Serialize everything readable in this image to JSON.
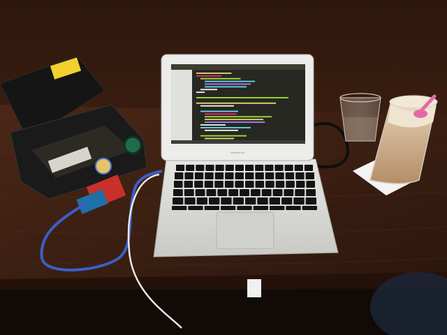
{
  "scene": {
    "laptop": {
      "brand_label": "MacBook Air",
      "editor_lines": [
        {
          "indent": 0,
          "len": 42,
          "color": "#e6db74"
        },
        {
          "indent": 0,
          "len": 30,
          "color": "#f92672"
        },
        {
          "indent": 1,
          "len": 48,
          "color": "#a6e22e"
        },
        {
          "indent": 2,
          "len": 60,
          "color": "#66d9ef"
        },
        {
          "indent": 2,
          "len": 55,
          "color": "#ae81ff"
        },
        {
          "indent": 2,
          "len": 50,
          "color": "#66d9ef"
        },
        {
          "indent": 1,
          "len": 20,
          "color": "#f8f8f2"
        },
        {
          "indent": 0,
          "len": 10,
          "color": "#f8f8f2"
        },
        {
          "indent": 0,
          "len": 0,
          "color": "#272822"
        },
        {
          "indent": 0,
          "len": 110,
          "color": "#a6e22e"
        },
        {
          "indent": 0,
          "len": 0,
          "color": "#272822"
        },
        {
          "indent": 0,
          "len": 95,
          "color": "#e6db74"
        },
        {
          "indent": 1,
          "len": 40,
          "color": "#f8f8f2"
        },
        {
          "indent": 0,
          "len": 0,
          "color": "#272822"
        },
        {
          "indent": 1,
          "len": 45,
          "color": "#66d9ef"
        },
        {
          "indent": 2,
          "len": 38,
          "color": "#f92672"
        },
        {
          "indent": 2,
          "len": 80,
          "color": "#a6e22e"
        },
        {
          "indent": 2,
          "len": 70,
          "color": "#e6db74"
        },
        {
          "indent": 2,
          "len": 72,
          "color": "#ae81ff"
        },
        {
          "indent": 1,
          "len": 30,
          "color": "#f8f8f2"
        },
        {
          "indent": 1,
          "len": 60,
          "color": "#66d9ef"
        },
        {
          "indent": 2,
          "len": 40,
          "color": "#f8f8f2"
        },
        {
          "indent": 0,
          "len": 0,
          "color": "#272822"
        },
        {
          "indent": 1,
          "len": 55,
          "color": "#a6e22e"
        },
        {
          "indent": 2,
          "len": 35,
          "color": "#e6db74"
        }
      ]
    },
    "colors": {
      "table": "#3a1f12",
      "wall": "#2a140c",
      "laptop_body": "#d9d9d6",
      "editor_bg": "#272822",
      "toolbox": "#1b1b1b",
      "toolbox_lid_sticker": "#f2d02e",
      "usb_cable": "#3c5ec9",
      "latte_foam": "#e8ddc9",
      "latte_coffee": "#c7a582",
      "straw": "#e46aa6"
    }
  }
}
